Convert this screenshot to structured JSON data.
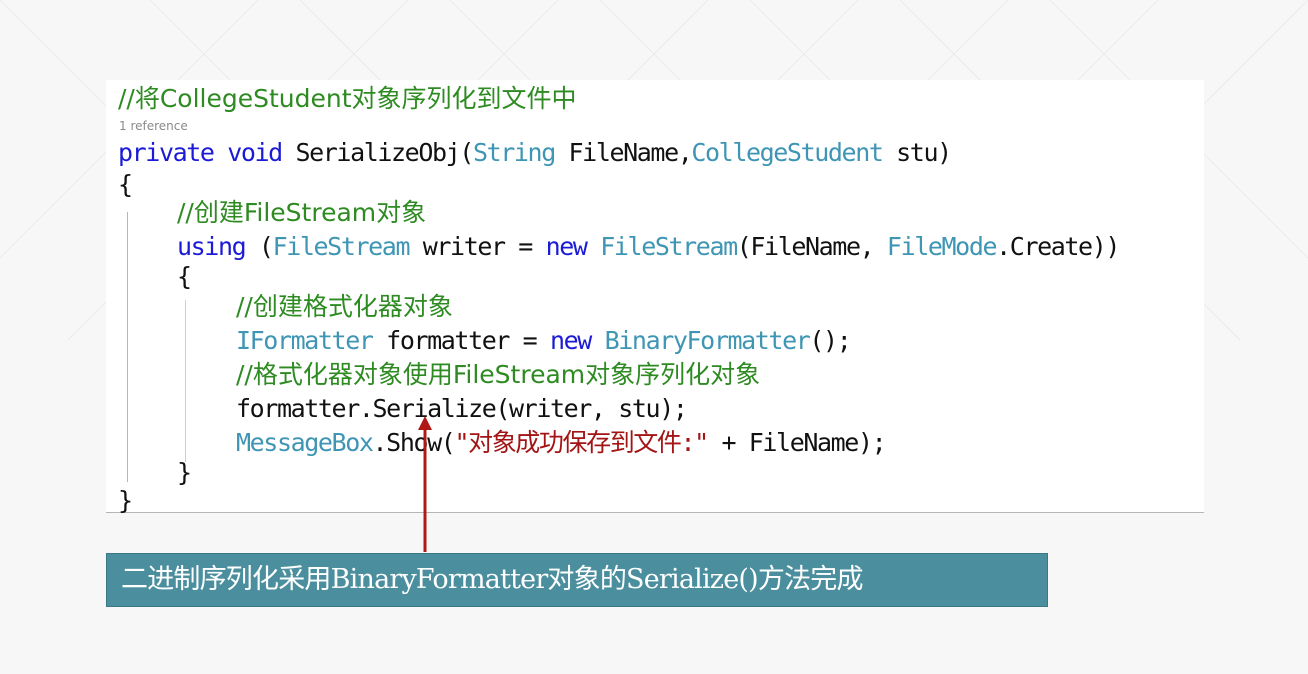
{
  "code": {
    "comment1": "//将CollegeStudent对象序列化到文件中",
    "reference": "1 reference",
    "sig": {
      "kw": "private void ",
      "name": "SerializeObj(",
      "t1": "String",
      "p1": " FileName,",
      "t2": "CollegeStudent",
      "p2": " stu)"
    },
    "brace_open": "{",
    "comment2": "//创建FileStream对象",
    "using": {
      "kw": "using",
      "p1": " (",
      "t1": "FileStream",
      "p2": " writer = ",
      "kw2": "new",
      "p3": " ",
      "t2": "FileStream",
      "p4": "(FileName, ",
      "t3": "FileMode",
      "p5": ".Create))"
    },
    "inner_open": "{",
    "comment3": "//创建格式化器对象",
    "formatter_decl": {
      "t1": "IFormatter",
      "p1": " formatter = ",
      "kw": "new",
      "p2": " ",
      "t2": "BinaryFormatter",
      "p3": "();"
    },
    "comment4": "//格式化器对象使用FileStream对象序列化对象",
    "serialize_call": "formatter.Serialize(writer, stu);",
    "msgbox": {
      "t1": "MessageBox",
      "p1": ".Show(",
      "str": "\"对象成功保存到文件:\"",
      "p2": " + FileName);"
    },
    "inner_close": "}",
    "brace_close": "}"
  },
  "caption": "二进制序列化采用BinaryFormatter对象的Serialize()方法完成",
  "colors": {
    "comment": "#2e8b22",
    "keyword": "#1b1bd6",
    "type": "#3f95b4",
    "string": "#a31515",
    "arrow": "#b01818",
    "caption_bg": "#4b8f9e"
  }
}
